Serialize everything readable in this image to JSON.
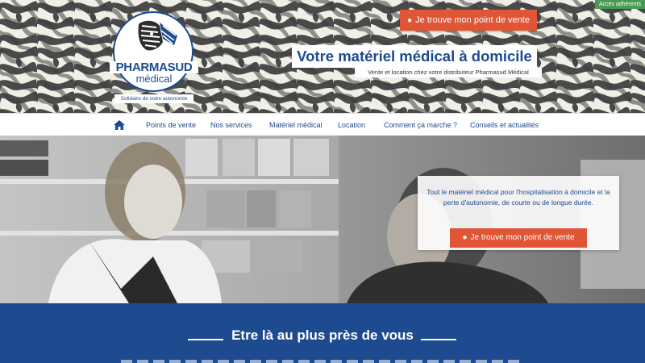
{
  "header": {
    "members_access": "Accès adhérents",
    "logo": {
      "name": "PHARMASUD",
      "sub": "médical",
      "tagline": "Solidaire de votre autonomie"
    },
    "cta_label": "Je trouve mon point de vente",
    "title": "Votre matériel médical à domicile",
    "subtitle": "Vente et location chez votre distributeur Pharmasud Médical"
  },
  "nav": {
    "home_icon": "home-icon",
    "items": [
      {
        "label": "Points de vente"
      },
      {
        "label": "Nos services"
      },
      {
        "label": "Matériel médical"
      },
      {
        "label": "Location"
      },
      {
        "label": "Comment ça marche ?"
      },
      {
        "label": "Conseils et actualités"
      }
    ]
  },
  "hero": {
    "text": "Tout le matériel médical pour l'hospitalisation à domicile et la perte d'autonomie, de courte ou de longue durée.",
    "cta_label": "Je trouve mon point de vente"
  },
  "section": {
    "title": "Etre là au plus près de vous"
  },
  "colors": {
    "brand_blue": "#1e4b8f",
    "cta_orange": "#e05535",
    "members_green": "#4a9a55"
  }
}
